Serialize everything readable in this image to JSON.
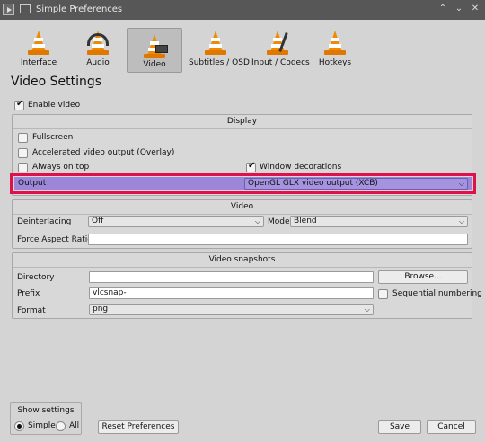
{
  "window": {
    "title": "Simple Preferences"
  },
  "categories": [
    {
      "label": "Interface"
    },
    {
      "label": "Audio"
    },
    {
      "label": "Video"
    },
    {
      "label": "Subtitles / OSD"
    },
    {
      "label": "Input / Codecs"
    },
    {
      "label": "Hotkeys"
    }
  ],
  "heading": "Video Settings",
  "enable_video": {
    "label": "Enable video",
    "checked": true
  },
  "display": {
    "title": "Display",
    "fullscreen": "Fullscreen",
    "accelerated": "Accelerated video output (Overlay)",
    "always_on_top": "Always on top",
    "window_decorations": "Window decorations",
    "output_label": "Output",
    "output_value": "OpenGL GLX video output (XCB)"
  },
  "video": {
    "title": "Video",
    "deinterlacing_label": "Deinterlacing",
    "deinterlacing_value": "Off",
    "mode_label": "Mode",
    "mode_value": "Blend",
    "aspect_label": "Force Aspect Ratio",
    "aspect_value": ""
  },
  "snapshots": {
    "title": "Video snapshots",
    "directory_label": "Directory",
    "directory_value": "",
    "browse": "Browse...",
    "prefix_label": "Prefix",
    "prefix_value": "vlcsnap-",
    "sequential": "Sequential numbering",
    "format_label": "Format",
    "format_value": "png"
  },
  "show_settings": {
    "title": "Show settings",
    "simple": "Simple",
    "all": "All"
  },
  "buttons": {
    "reset": "Reset Preferences",
    "save": "Save",
    "cancel": "Cancel"
  }
}
